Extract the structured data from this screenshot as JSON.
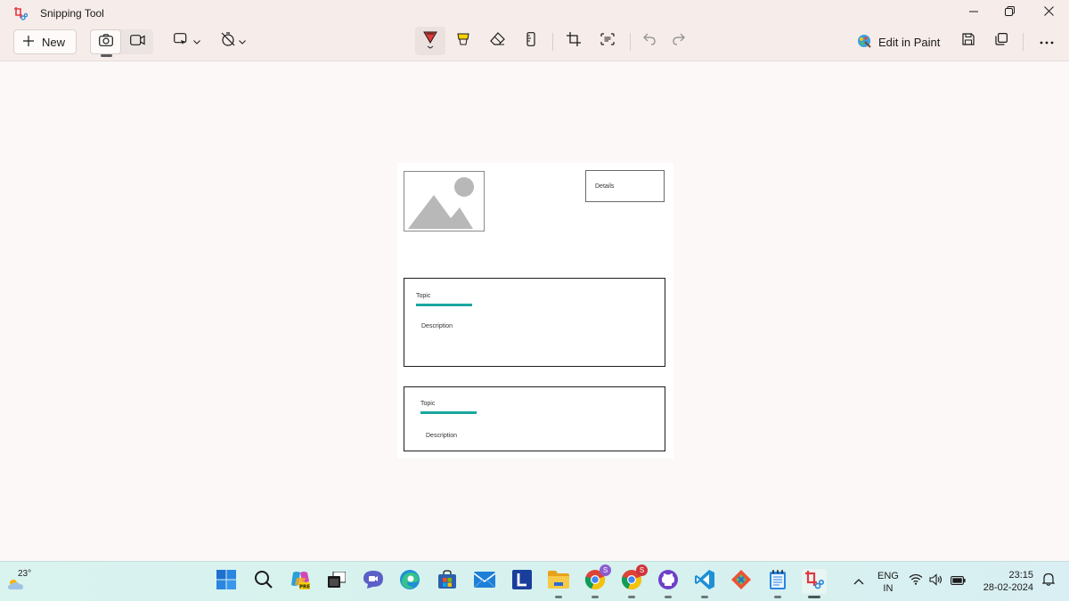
{
  "app": {
    "title": "Snipping Tool"
  },
  "toolbar": {
    "new_label": "New",
    "edit_in_paint_label": "Edit in Paint",
    "tools": [
      "pen-icon",
      "highlighter-icon",
      "eraser-icon",
      "ruler-icon",
      "crop-icon",
      "text-actions-icon",
      "undo-icon",
      "redo-icon"
    ]
  },
  "capture": {
    "details_label": "Details",
    "cards": [
      {
        "topic": "Topic",
        "description": "Description"
      },
      {
        "topic": "Topic",
        "description": "Description"
      }
    ],
    "accent_color": "#1aa6a0"
  },
  "taskbar": {
    "weather_temp": "23°",
    "apps": [
      "start-icon",
      "search-icon",
      "copilot-icon",
      "task-view-icon",
      "teams-chat-icon",
      "edge-icon",
      "store-icon",
      "mail-icon",
      "l-app-icon",
      "file-explorer-icon",
      "chrome-icon",
      "chrome-profile-icon",
      "github-desktop-icon",
      "vscode-icon",
      "git-extension-icon",
      "notepad-icon",
      "snipping-tool-icon"
    ],
    "chrome_badges": [
      "S",
      "S"
    ],
    "language": "ENG",
    "region": "IN",
    "time": "23:15",
    "date": "28-02-2024"
  }
}
